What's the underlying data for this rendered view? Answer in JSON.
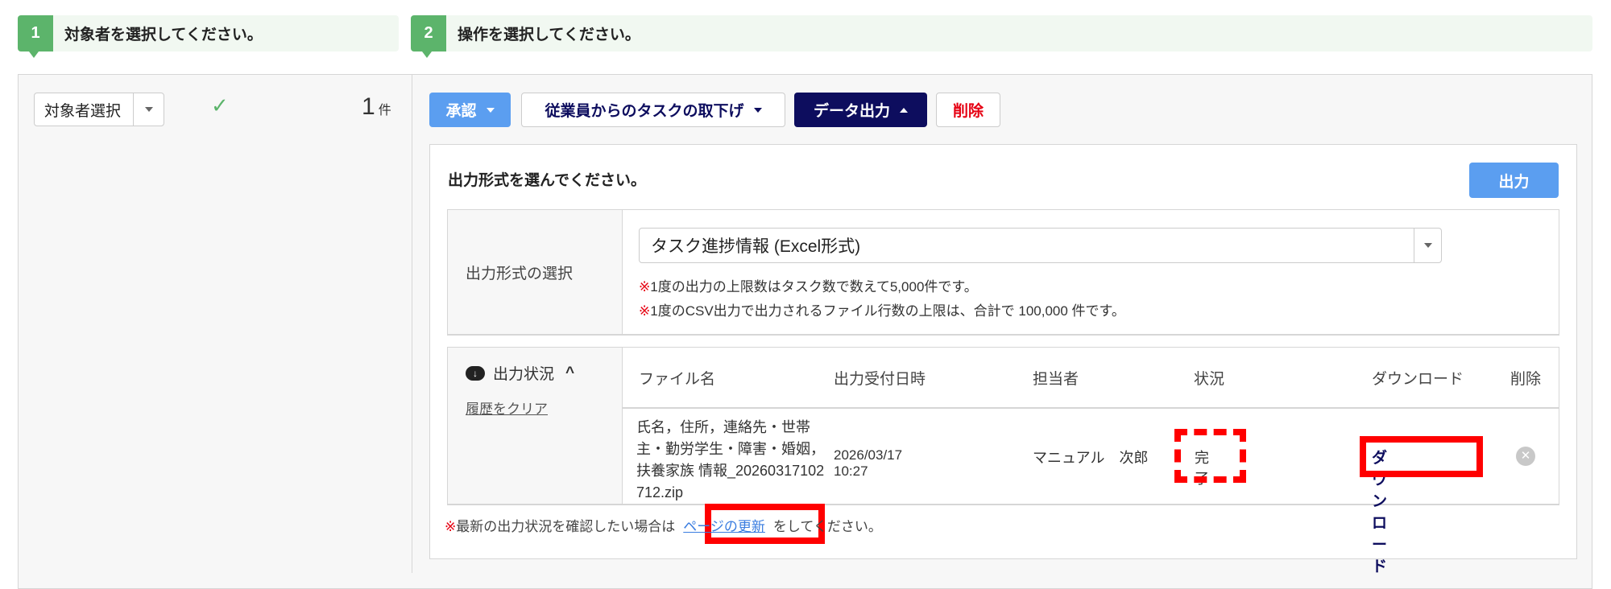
{
  "steps": [
    {
      "num": "1",
      "text": "対象者を選択してください。"
    },
    {
      "num": "2",
      "text": "操作を選択してください。"
    }
  ],
  "left": {
    "select_label": "対象者選択",
    "count": "1",
    "count_unit": "件"
  },
  "toolbar": {
    "approve": "承認",
    "withdraw": "従業員からのタスクの取下げ",
    "export": "データ出力",
    "delete": "削除"
  },
  "export_panel": {
    "title": "出力形式を選んでください。",
    "output_button": "出力",
    "format_label": "出力形式の選択",
    "format_value": "タスク進捗情報 (Excel形式)",
    "notes": [
      {
        "mark": "※",
        "text": "1度の出力の上限数はタスク数で数えて5,000件です。"
      },
      {
        "mark": "※",
        "text": "1度のCSV出力で出力されるファイル行数の上限は、合計で 100,000 件です。"
      }
    ]
  },
  "status": {
    "label": "出力状況",
    "clear_link": "履歴をクリア",
    "columns": [
      "ファイル名",
      "出力受付日時",
      "担当者",
      "状況",
      "ダウンロード",
      "削除"
    ],
    "rows": [
      {
        "file": "氏名，住所，連絡先・世帯主・勤労学生・障害・婚姻，扶養家族 情報_20260317102712.zip",
        "datetime": "2026/03/17 10:27",
        "owner": "マニュアル　次郎",
        "state": "完了",
        "download": "ダウンロード"
      }
    ]
  },
  "footer": {
    "mark": "※",
    "before": "最新の出力状況を確認したい場合は",
    "link": "ページの更新",
    "after": "をしてください。"
  },
  "colors": {
    "accent_green": "#5cb46b",
    "approve_blue": "#5b9ef0",
    "navy": "#0d0d5e",
    "highlight_red": "#ff0000"
  }
}
